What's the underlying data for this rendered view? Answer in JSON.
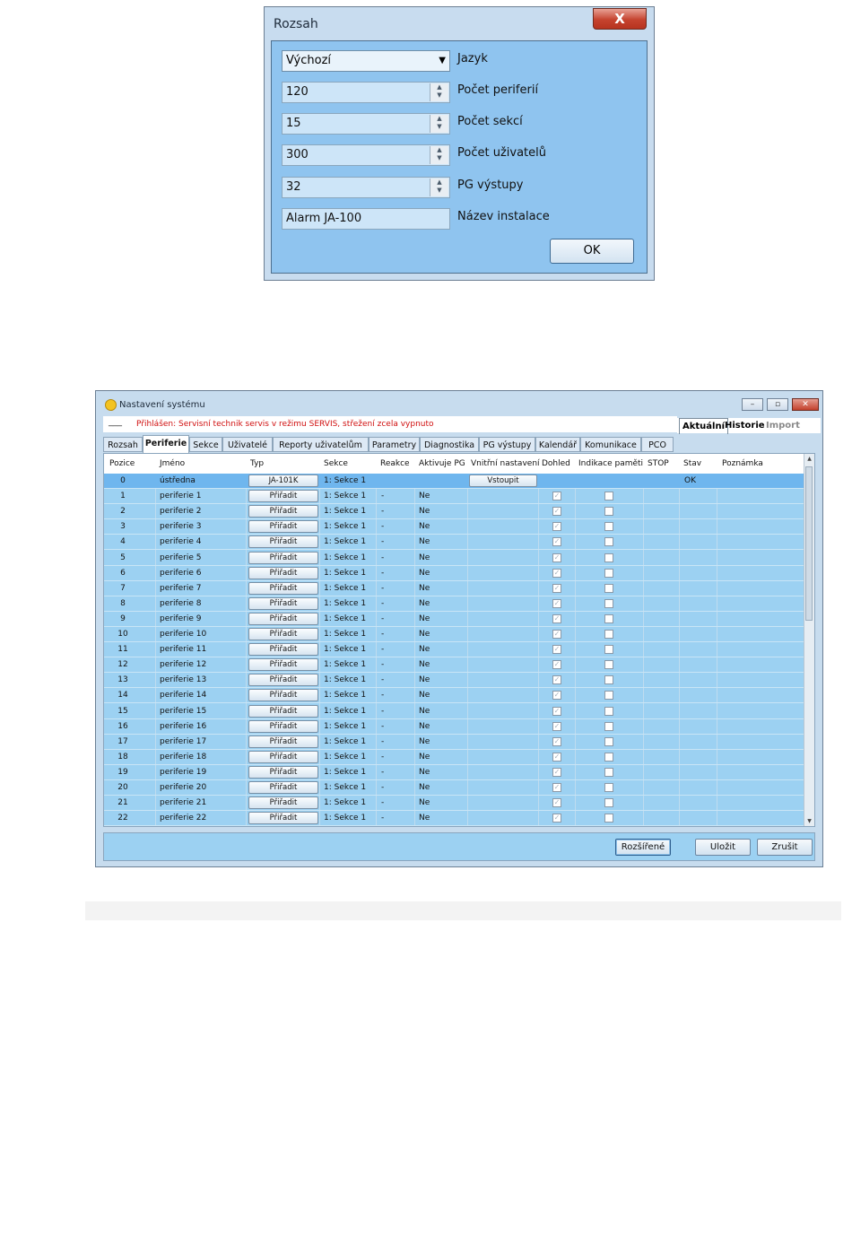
{
  "rozsah_dialog": {
    "title": "Rozsah",
    "close_label": "X",
    "language": {
      "value": "Výchozí",
      "label": "Jazyk"
    },
    "fields": [
      {
        "value": "120",
        "label": "Počet periferií"
      },
      {
        "value": "15",
        "label": "Počet sekcí"
      },
      {
        "value": "300",
        "label": "Počet uživatelů"
      },
      {
        "value": "32",
        "label": "PG výstupy"
      }
    ],
    "install_name": {
      "value": "Alarm JA-100",
      "label": "Název instalace"
    },
    "ok_label": "OK"
  },
  "system_dialog": {
    "title": "Nastavení systému",
    "window_buttons": [
      "–",
      "▫",
      "✕"
    ],
    "status_dash": "___",
    "status_message": "Přihlášen: Servisní technik servis v režimu SERVIS, střežení zcela vypnuto",
    "view_tabs": [
      "Aktuální",
      "Historie",
      "Import"
    ],
    "tabs": [
      "Rozsah",
      "Periferie",
      "Sekce",
      "Uživatelé",
      "Reporty uživatelům",
      "Parametry",
      "Diagnostika",
      "PG výstupy",
      "Kalendář",
      "Komunikace",
      "PCO"
    ],
    "active_tab": "Periferie",
    "columns": [
      "Pozice",
      "Jméno",
      "Typ",
      "Sekce",
      "Reakce",
      "Aktivuje PG",
      "Vnitřní nastavení",
      "Dohled",
      "Indikace paměti",
      "STOP",
      "Stav",
      "Poznámka"
    ],
    "rows": [
      {
        "pos": "0",
        "name": "ústředna",
        "type": "JA-101K",
        "section": "1: Sekce 1",
        "reaction": "",
        "activates_pg": "",
        "internal": "Vstoupit",
        "status": "OK"
      },
      {
        "pos": "1",
        "name": "periferie 1",
        "type": "Přiřadit",
        "section": "1: Sekce 1",
        "reaction": "-",
        "activates_pg": "Ne"
      },
      {
        "pos": "2",
        "name": "periferie 2",
        "type": "Přiřadit",
        "section": "1: Sekce 1",
        "reaction": "-",
        "activates_pg": "Ne"
      },
      {
        "pos": "3",
        "name": "periferie 3",
        "type": "Přiřadit",
        "section": "1: Sekce 1",
        "reaction": "-",
        "activates_pg": "Ne"
      },
      {
        "pos": "4",
        "name": "periferie 4",
        "type": "Přiřadit",
        "section": "1: Sekce 1",
        "reaction": "-",
        "activates_pg": "Ne"
      },
      {
        "pos": "5",
        "name": "periferie 5",
        "type": "Přiřadit",
        "section": "1: Sekce 1",
        "reaction": "-",
        "activates_pg": "Ne"
      },
      {
        "pos": "6",
        "name": "periferie 6",
        "type": "Přiřadit",
        "section": "1: Sekce 1",
        "reaction": "-",
        "activates_pg": "Ne"
      },
      {
        "pos": "7",
        "name": "periferie 7",
        "type": "Přiřadit",
        "section": "1: Sekce 1",
        "reaction": "-",
        "activates_pg": "Ne"
      },
      {
        "pos": "8",
        "name": "periferie 8",
        "type": "Přiřadit",
        "section": "1: Sekce 1",
        "reaction": "-",
        "activates_pg": "Ne"
      },
      {
        "pos": "9",
        "name": "periferie 9",
        "type": "Přiřadit",
        "section": "1: Sekce 1",
        "reaction": "-",
        "activates_pg": "Ne"
      },
      {
        "pos": "10",
        "name": "periferie 10",
        "type": "Přiřadit",
        "section": "1: Sekce 1",
        "reaction": "-",
        "activates_pg": "Ne"
      },
      {
        "pos": "11",
        "name": "periferie 11",
        "type": "Přiřadit",
        "section": "1: Sekce 1",
        "reaction": "-",
        "activates_pg": "Ne"
      },
      {
        "pos": "12",
        "name": "periferie 12",
        "type": "Přiřadit",
        "section": "1: Sekce 1",
        "reaction": "-",
        "activates_pg": "Ne"
      },
      {
        "pos": "13",
        "name": "periferie 13",
        "type": "Přiřadit",
        "section": "1: Sekce 1",
        "reaction": "-",
        "activates_pg": "Ne"
      },
      {
        "pos": "14",
        "name": "periferie 14",
        "type": "Přiřadit",
        "section": "1: Sekce 1",
        "reaction": "-",
        "activates_pg": "Ne"
      },
      {
        "pos": "15",
        "name": "periferie 15",
        "type": "Přiřadit",
        "section": "1: Sekce 1",
        "reaction": "-",
        "activates_pg": "Ne"
      },
      {
        "pos": "16",
        "name": "periferie 16",
        "type": "Přiřadit",
        "section": "1: Sekce 1",
        "reaction": "-",
        "activates_pg": "Ne"
      },
      {
        "pos": "17",
        "name": "periferie 17",
        "type": "Přiřadit",
        "section": "1: Sekce 1",
        "reaction": "-",
        "activates_pg": "Ne"
      },
      {
        "pos": "18",
        "name": "periferie 18",
        "type": "Přiřadit",
        "section": "1: Sekce 1",
        "reaction": "-",
        "activates_pg": "Ne"
      },
      {
        "pos": "19",
        "name": "periferie 19",
        "type": "Přiřadit",
        "section": "1: Sekce 1",
        "reaction": "-",
        "activates_pg": "Ne"
      },
      {
        "pos": "20",
        "name": "periferie 20",
        "type": "Přiřadit",
        "section": "1: Sekce 1",
        "reaction": "-",
        "activates_pg": "Ne"
      },
      {
        "pos": "21",
        "name": "periferie 21",
        "type": "Přiřadit",
        "section": "1: Sekce 1",
        "reaction": "-",
        "activates_pg": "Ne"
      },
      {
        "pos": "22",
        "name": "periferie 22",
        "type": "Přiřadit",
        "section": "1: Sekce 1",
        "reaction": "-",
        "activates_pg": "Ne"
      }
    ],
    "buttons": {
      "advanced": "Rozšířené",
      "save": "Uložit",
      "cancel": "Zrušit"
    }
  }
}
